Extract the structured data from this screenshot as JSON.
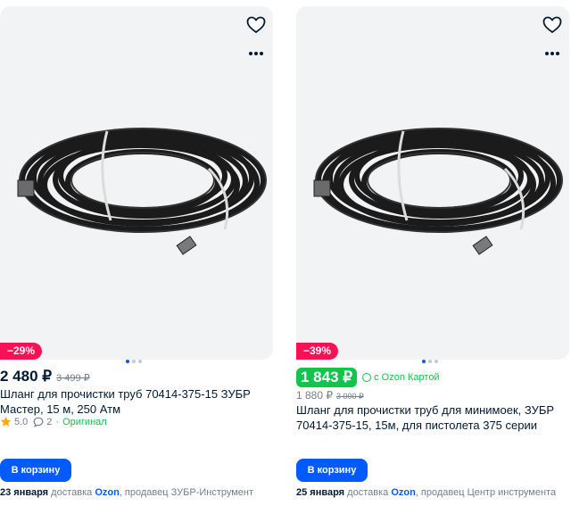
{
  "products": [
    {
      "discount": "−29%",
      "price": "2 480 ₽",
      "old_price": "3 499 ₽",
      "title": "Шланг для прочистки труб 70414-375-15 ЗУБР Мастер, 15 м, 250 Атм",
      "rating": "5.0",
      "reviews": "2",
      "original": "Оригинал",
      "cart_button": "В корзину",
      "delivery_date": "23 января",
      "delivery_text": "доставка",
      "delivery_brand": "Ozon",
      "seller_text": ", продавец ЗУБР-Инструмент",
      "icons": [
        "heart-icon",
        "more-icon",
        "star-icon",
        "comment-icon"
      ]
    },
    {
      "discount": "−39%",
      "card_price": "1 843 ₽",
      "card_label": "с Ozon Картой",
      "price": "1 880 ₽",
      "old_price": "3 000 ₽",
      "title": "Шланг для прочистки труб для минимоек, ЗУБР 70414-375-15, 15м, для пистолета 375 серии",
      "cart_button": "В корзину",
      "delivery_date": "25 января",
      "delivery_text": "доставка",
      "delivery_brand": "Ozon",
      "seller_text": ", продавец Центр инструмента",
      "icons": [
        "heart-icon",
        "more-icon",
        "ozon-card-check-icon"
      ]
    }
  ],
  "colors": {
    "discount_badge": "#f91155",
    "ozon_card_green": "#10c44c",
    "button_blue": "#005bff",
    "image_bg": "#f2f3f5"
  }
}
